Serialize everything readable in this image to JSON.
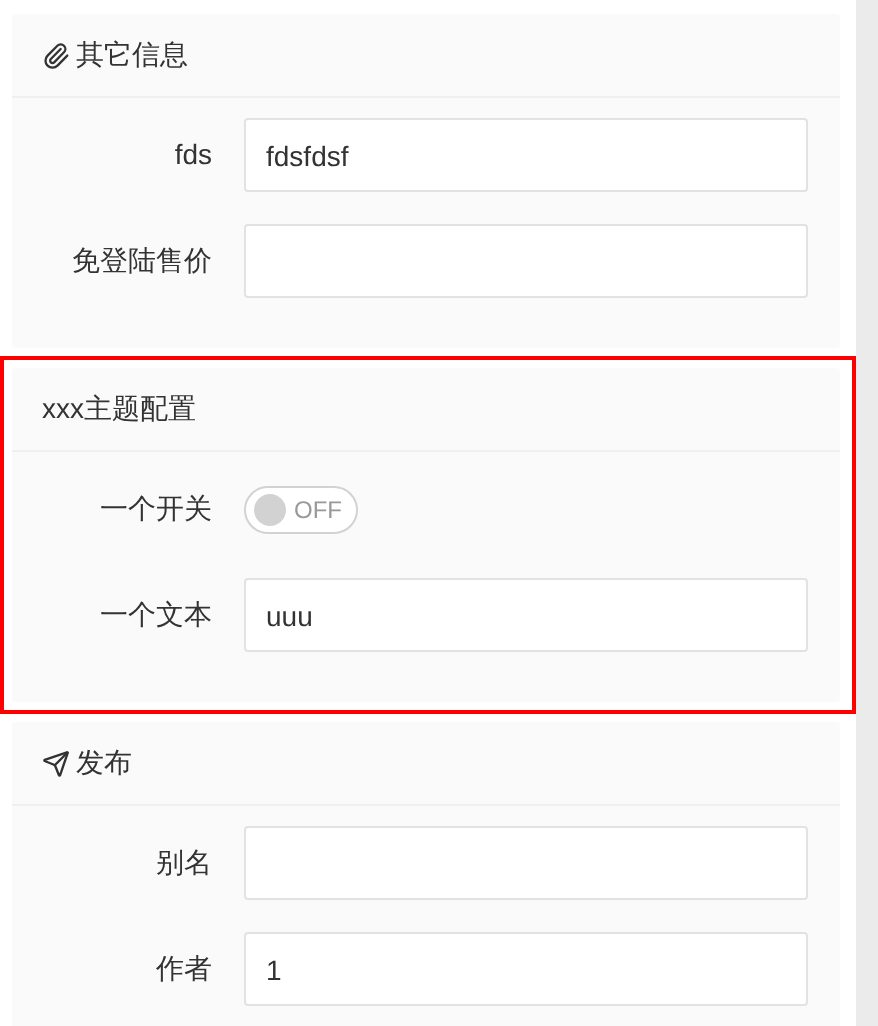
{
  "sections": [
    {
      "title": "其它信息",
      "highlighted": false,
      "fields": [
        {
          "kind": "text",
          "label": "fds",
          "value": "fdsfdsf"
        },
        {
          "kind": "text",
          "label": "免登陆售价"
        }
      ]
    },
    {
      "title": "xxx主题配置",
      "highlighted": true,
      "fields": [
        {
          "kind": "switch",
          "label": "一个开关",
          "on": false,
          "state_text": "OFF"
        },
        {
          "kind": "text",
          "label": "一个文本",
          "value": "uuu"
        }
      ]
    },
    {
      "title": "发布",
      "highlighted": false,
      "fields": [
        {
          "kind": "text",
          "label": "别名"
        },
        {
          "kind": "text",
          "label": "作者",
          "value": "1"
        }
      ]
    }
  ]
}
